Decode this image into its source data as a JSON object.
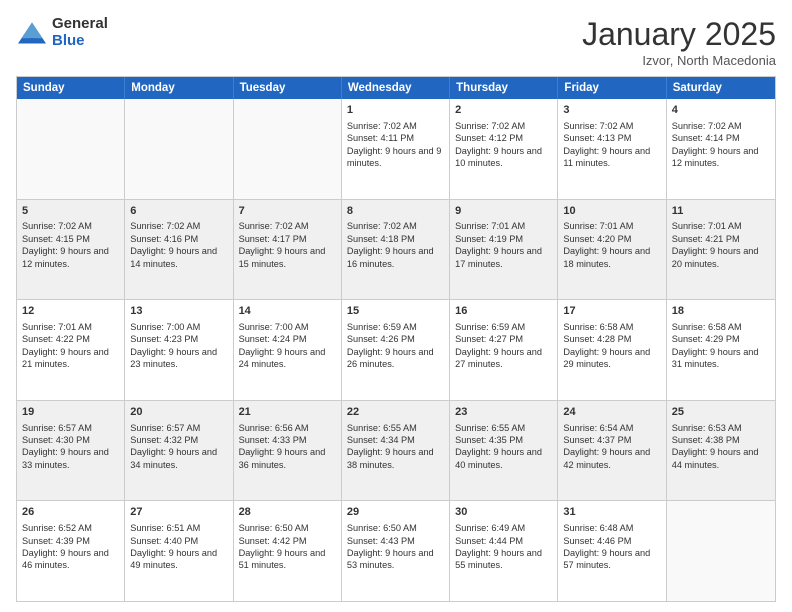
{
  "logo": {
    "general": "General",
    "blue": "Blue"
  },
  "header": {
    "month": "January 2025",
    "location": "Izvor, North Macedonia"
  },
  "weekdays": [
    "Sunday",
    "Monday",
    "Tuesday",
    "Wednesday",
    "Thursday",
    "Friday",
    "Saturday"
  ],
  "weeks": [
    [
      {
        "day": "",
        "empty": true
      },
      {
        "day": "",
        "empty": true
      },
      {
        "day": "",
        "empty": true
      },
      {
        "day": "1",
        "rise": "7:02 AM",
        "set": "4:11 PM",
        "daylight": "9 hours and 9 minutes."
      },
      {
        "day": "2",
        "rise": "7:02 AM",
        "set": "4:12 PM",
        "daylight": "9 hours and 10 minutes."
      },
      {
        "day": "3",
        "rise": "7:02 AM",
        "set": "4:13 PM",
        "daylight": "9 hours and 11 minutes."
      },
      {
        "day": "4",
        "rise": "7:02 AM",
        "set": "4:14 PM",
        "daylight": "9 hours and 12 minutes."
      }
    ],
    [
      {
        "day": "5",
        "rise": "7:02 AM",
        "set": "4:15 PM",
        "daylight": "9 hours and 12 minutes."
      },
      {
        "day": "6",
        "rise": "7:02 AM",
        "set": "4:16 PM",
        "daylight": "9 hours and 14 minutes."
      },
      {
        "day": "7",
        "rise": "7:02 AM",
        "set": "4:17 PM",
        "daylight": "9 hours and 15 minutes."
      },
      {
        "day": "8",
        "rise": "7:02 AM",
        "set": "4:18 PM",
        "daylight": "9 hours and 16 minutes."
      },
      {
        "day": "9",
        "rise": "7:01 AM",
        "set": "4:19 PM",
        "daylight": "9 hours and 17 minutes."
      },
      {
        "day": "10",
        "rise": "7:01 AM",
        "set": "4:20 PM",
        "daylight": "9 hours and 18 minutes."
      },
      {
        "day": "11",
        "rise": "7:01 AM",
        "set": "4:21 PM",
        "daylight": "9 hours and 20 minutes."
      }
    ],
    [
      {
        "day": "12",
        "rise": "7:01 AM",
        "set": "4:22 PM",
        "daylight": "9 hours and 21 minutes."
      },
      {
        "day": "13",
        "rise": "7:00 AM",
        "set": "4:23 PM",
        "daylight": "9 hours and 23 minutes."
      },
      {
        "day": "14",
        "rise": "7:00 AM",
        "set": "4:24 PM",
        "daylight": "9 hours and 24 minutes."
      },
      {
        "day": "15",
        "rise": "6:59 AM",
        "set": "4:26 PM",
        "daylight": "9 hours and 26 minutes."
      },
      {
        "day": "16",
        "rise": "6:59 AM",
        "set": "4:27 PM",
        "daylight": "9 hours and 27 minutes."
      },
      {
        "day": "17",
        "rise": "6:58 AM",
        "set": "4:28 PM",
        "daylight": "9 hours and 29 minutes."
      },
      {
        "day": "18",
        "rise": "6:58 AM",
        "set": "4:29 PM",
        "daylight": "9 hours and 31 minutes."
      }
    ],
    [
      {
        "day": "19",
        "rise": "6:57 AM",
        "set": "4:30 PM",
        "daylight": "9 hours and 33 minutes."
      },
      {
        "day": "20",
        "rise": "6:57 AM",
        "set": "4:32 PM",
        "daylight": "9 hours and 34 minutes."
      },
      {
        "day": "21",
        "rise": "6:56 AM",
        "set": "4:33 PM",
        "daylight": "9 hours and 36 minutes."
      },
      {
        "day": "22",
        "rise": "6:55 AM",
        "set": "4:34 PM",
        "daylight": "9 hours and 38 minutes."
      },
      {
        "day": "23",
        "rise": "6:55 AM",
        "set": "4:35 PM",
        "daylight": "9 hours and 40 minutes."
      },
      {
        "day": "24",
        "rise": "6:54 AM",
        "set": "4:37 PM",
        "daylight": "9 hours and 42 minutes."
      },
      {
        "day": "25",
        "rise": "6:53 AM",
        "set": "4:38 PM",
        "daylight": "9 hours and 44 minutes."
      }
    ],
    [
      {
        "day": "26",
        "rise": "6:52 AM",
        "set": "4:39 PM",
        "daylight": "9 hours and 46 minutes."
      },
      {
        "day": "27",
        "rise": "6:51 AM",
        "set": "4:40 PM",
        "daylight": "9 hours and 49 minutes."
      },
      {
        "day": "28",
        "rise": "6:50 AM",
        "set": "4:42 PM",
        "daylight": "9 hours and 51 minutes."
      },
      {
        "day": "29",
        "rise": "6:50 AM",
        "set": "4:43 PM",
        "daylight": "9 hours and 53 minutes."
      },
      {
        "day": "30",
        "rise": "6:49 AM",
        "set": "4:44 PM",
        "daylight": "9 hours and 55 minutes."
      },
      {
        "day": "31",
        "rise": "6:48 AM",
        "set": "4:46 PM",
        "daylight": "9 hours and 57 minutes."
      },
      {
        "day": "",
        "empty": true
      }
    ]
  ]
}
